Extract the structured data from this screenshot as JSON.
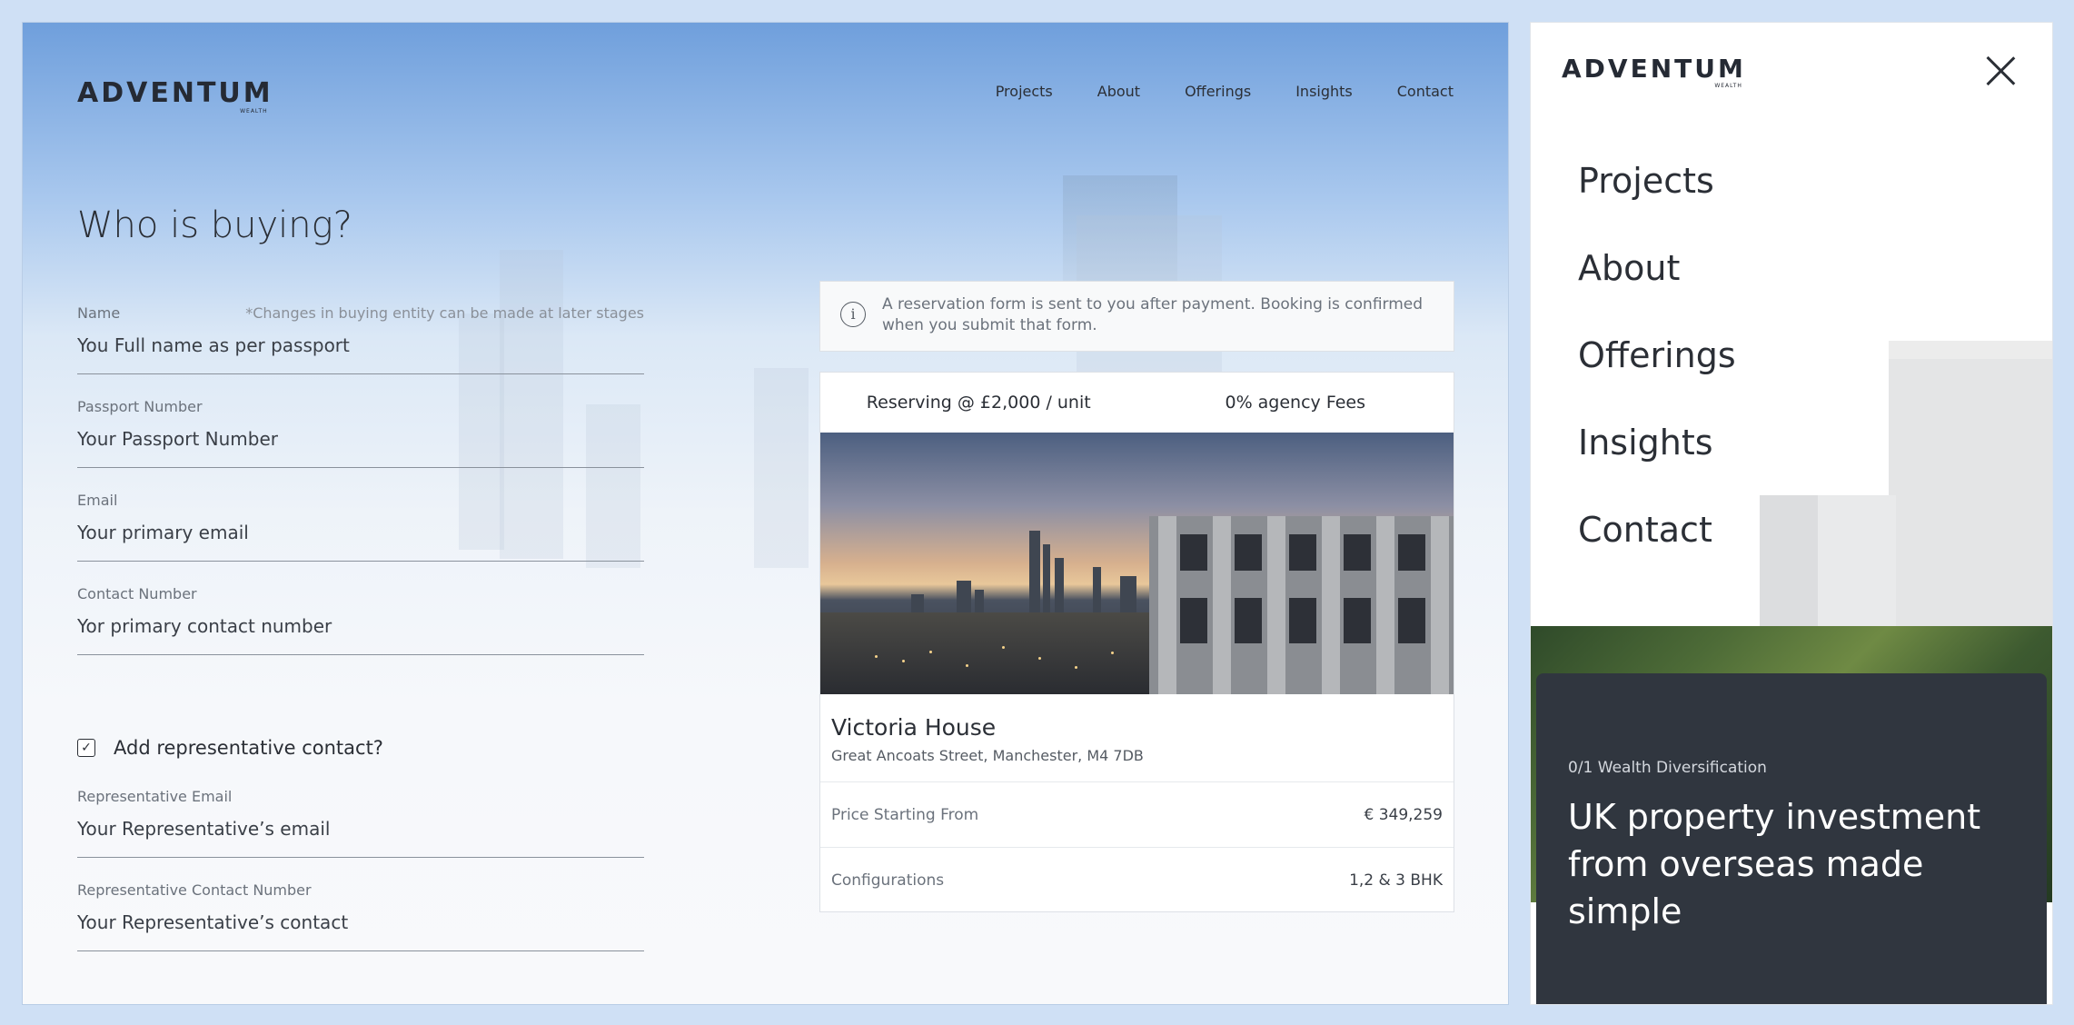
{
  "brand": {
    "logo": "ADVENTUM",
    "logo_sub": "WEALTH"
  },
  "nav": [
    "Projects",
    "About",
    "Offerings",
    "Insights",
    "Contact"
  ],
  "form": {
    "title": "Who is buying?",
    "name": {
      "label": "Name",
      "note": "*Changes in buying entity can be made at later stages",
      "placeholder": "You Full name as per passport"
    },
    "passport": {
      "label": "Passport Number",
      "placeholder": "Your Passport Number"
    },
    "email": {
      "label": "Email",
      "placeholder": "Your primary email"
    },
    "contact": {
      "label": "Contact Number",
      "placeholder": "Yor primary contact number"
    },
    "rep_checkbox": {
      "label": "Add representative contact?",
      "checked": true
    },
    "rep_email": {
      "label": "Representative Email",
      "placeholder": "Your Representative’s email"
    },
    "rep_contact": {
      "label": "Representative Contact Number",
      "placeholder": "Your Representative’s contact"
    }
  },
  "info": "A reservation form is sent to you after payment. Booking is confirmed when you submit that form.",
  "property": {
    "tag_reserving": "Reserving @ £2,000 / unit",
    "tag_fees": "0% agency Fees",
    "name": "Victoria House",
    "address": "Great Ancoats Street, Manchester, M4 7DB",
    "price_label": "Price Starting From",
    "price_value": "€ 349,259",
    "config_label": "Configurations",
    "config_value": "1,2 & 3 BHK"
  },
  "panel": {
    "menu": [
      "Projects",
      "About",
      "Offerings",
      "Insights",
      "Contact"
    ],
    "promo_eyebrow": "0/1 Wealth Diversification",
    "promo_headline": "UK property investment from overseas made simple"
  },
  "colors": {
    "accent_blue": "#6f9fdc",
    "promo_bg": "#30363f",
    "text": "#2b2f36"
  },
  "icons": [
    "info-icon",
    "check-icon",
    "close-icon"
  ]
}
